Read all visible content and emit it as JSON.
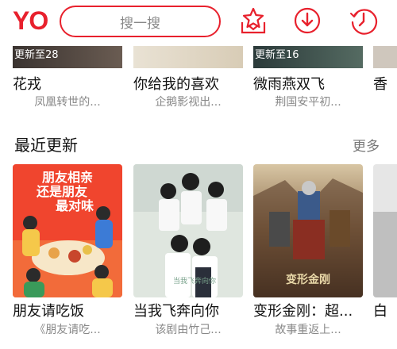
{
  "header": {
    "logo": "YO",
    "search_placeholder": "搜一搜",
    "icons": [
      "vip-star-icon",
      "download-icon",
      "history-clock-icon"
    ],
    "accent_color": "#e8212d"
  },
  "top_row": [
    {
      "badge": "更新至28",
      "title": "花戎",
      "subtitle": "凤凰转世的..."
    },
    {
      "badge": "",
      "title": "你给我的喜欢",
      "subtitle": "企鹅影视出..."
    },
    {
      "badge": "更新至16",
      "title": "微雨燕双飞",
      "subtitle": "荆国安平初..."
    },
    {
      "badge": "",
      "title": "香",
      "subtitle": ""
    }
  ],
  "section": {
    "title": "最近更新",
    "more_label": "更多"
  },
  "recent": [
    {
      "title": "朋友请吃饭",
      "subtitle": "《朋友请吃...",
      "poster_text": "朋友相亲还是朋友最对味"
    },
    {
      "title": "当我飞奔向你",
      "subtitle": "该剧由竹己...",
      "poster_text": ""
    },
    {
      "title": "变形金刚：超...",
      "subtitle": "故事重返上...",
      "poster_text": "变形金刚"
    },
    {
      "title": "白",
      "subtitle": "",
      "poster_text": ""
    }
  ]
}
